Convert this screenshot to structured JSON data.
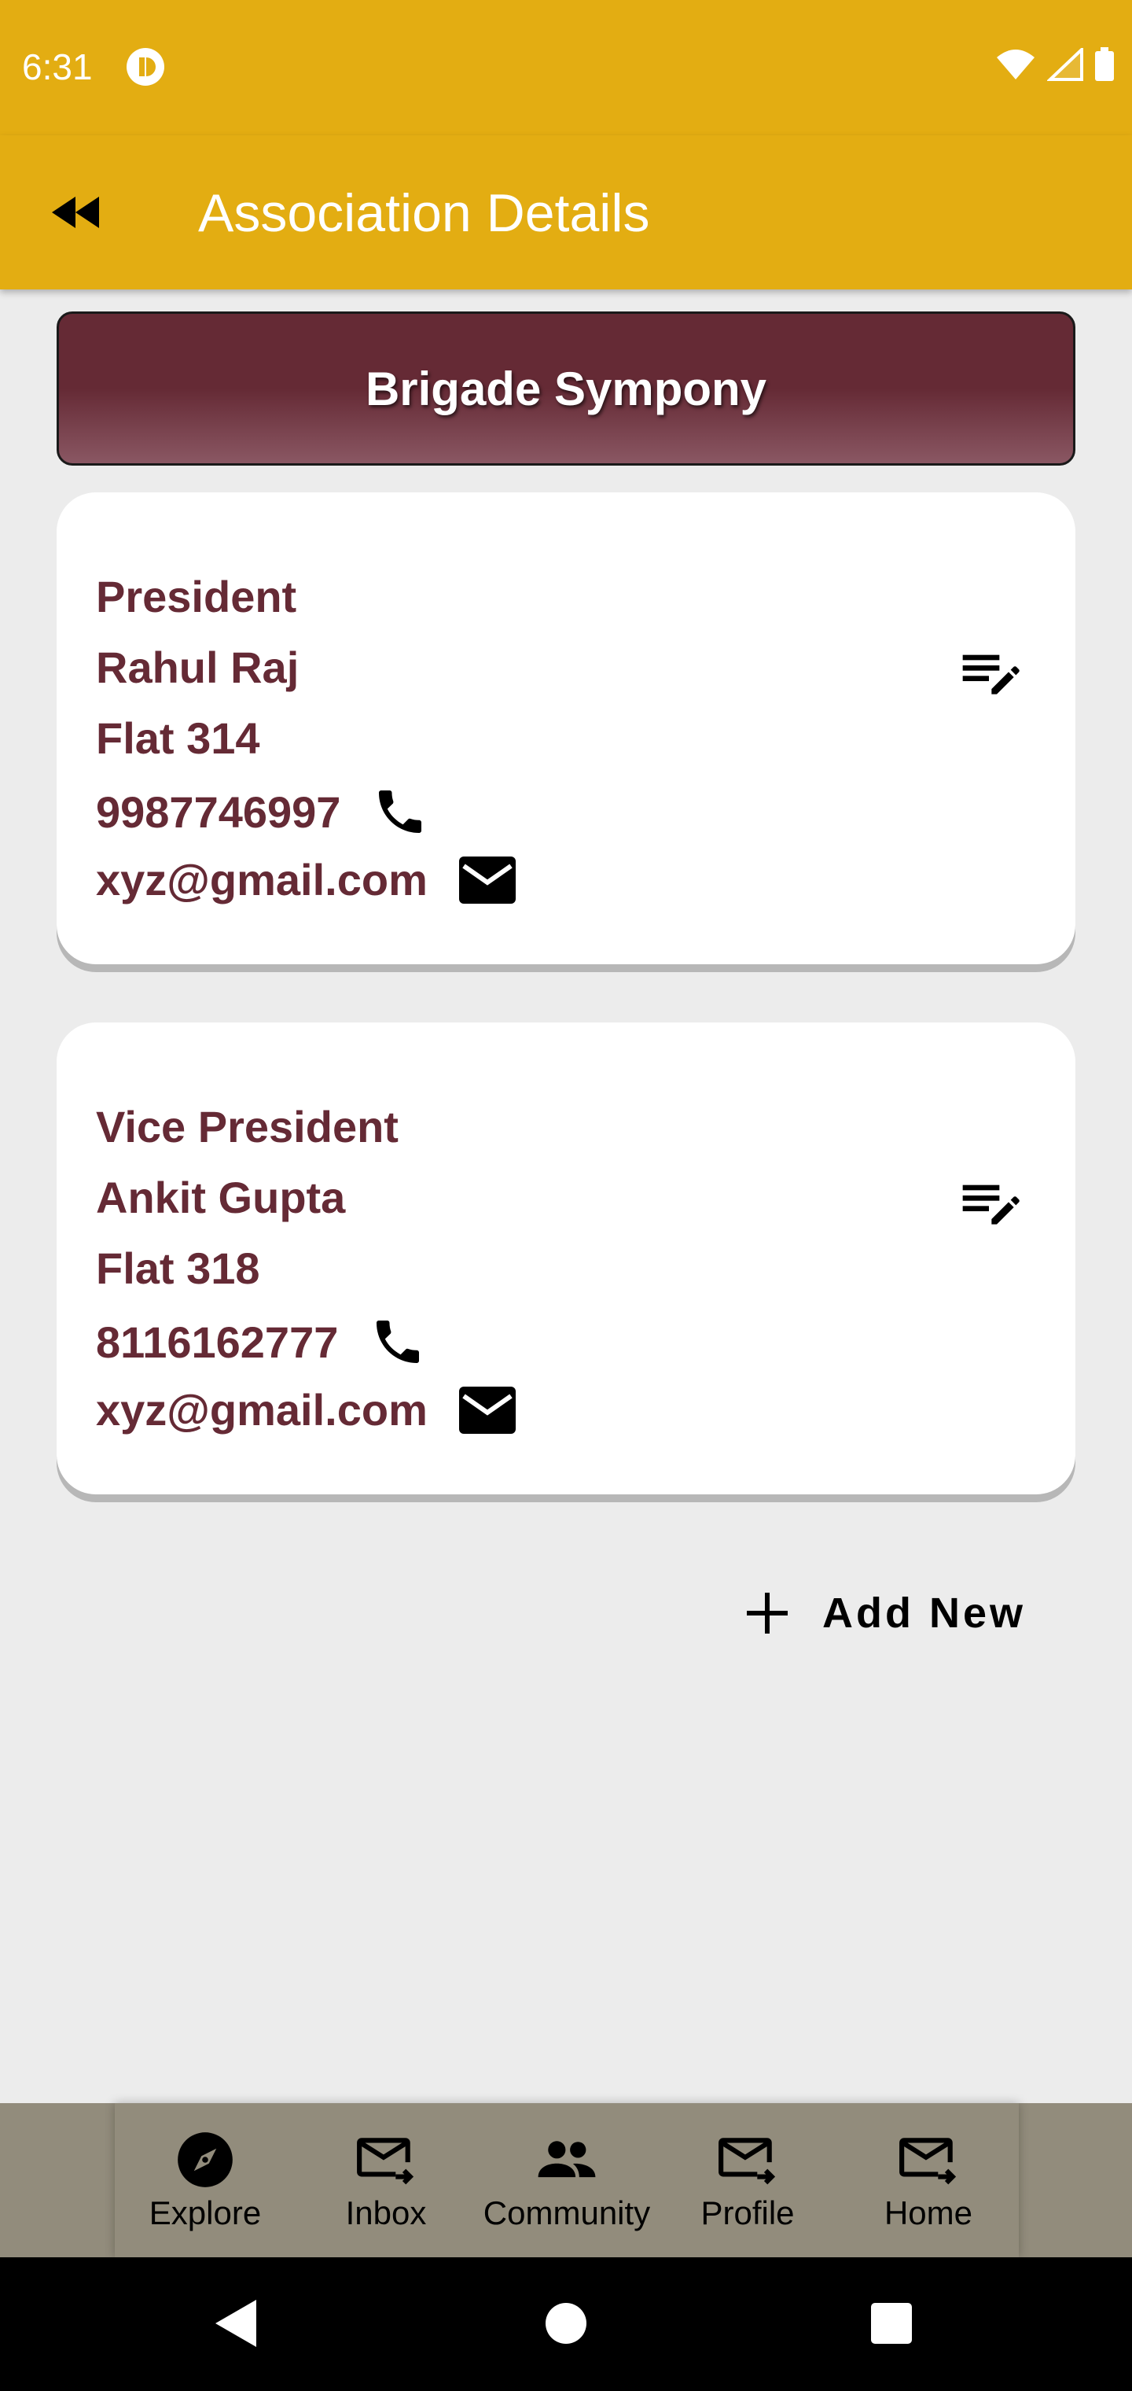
{
  "status_bar": {
    "time": "6:31",
    "icons": [
      "app-notification-icon",
      "wifi-icon",
      "signal-icon",
      "battery-icon"
    ]
  },
  "app_bar": {
    "title": "Association Details",
    "back_icon": "rewind-back-icon"
  },
  "banner": {
    "title": "Brigade Sympony"
  },
  "members": [
    {
      "role": "President",
      "name": "Rahul Raj",
      "flat": "Flat 314",
      "phone": "9987746997",
      "email": "xyz@gmail.com"
    },
    {
      "role": "Vice President",
      "name": "Ankit Gupta",
      "flat": "Flat 318",
      "phone": "8116162777",
      "email": "xyz@gmail.com"
    }
  ],
  "add_new": {
    "label": "Add New",
    "icon": "plus-icon"
  },
  "bottom_nav": {
    "items": [
      {
        "label": "Explore",
        "icon": "compass-icon"
      },
      {
        "label": "Inbox",
        "icon": "mail-forward-icon"
      },
      {
        "label": "Community",
        "icon": "people-icon"
      },
      {
        "label": "Profile",
        "icon": "mail-forward-icon"
      },
      {
        "label": "Home",
        "icon": "mail-forward-icon"
      }
    ]
  },
  "system_nav": [
    "back-triangle-icon",
    "home-circle-icon",
    "recents-square-icon"
  ],
  "colors": {
    "primary": "#e3ad12",
    "accent": "#652a35",
    "background": "#ececec",
    "nav_bar": "#928c7c"
  }
}
